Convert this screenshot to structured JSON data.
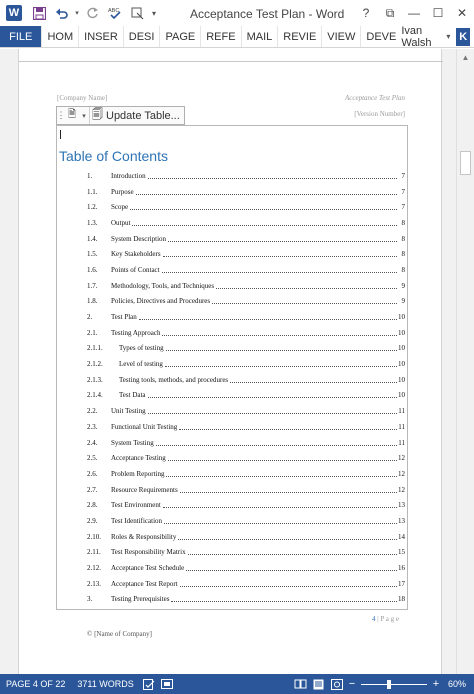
{
  "title_bar": {
    "app_logo": "W",
    "document_title": "Acceptance Test Plan - Word",
    "help": "?",
    "ribbon_display": "⧉",
    "minimize": "—",
    "maximize": "☐",
    "close": "✕",
    "quick_access": {
      "save_icon": "save-icon",
      "undo_icon": "undo-icon",
      "redo_icon": "redo-icon",
      "spelling_icon": "spelling-icon",
      "touch_mode_icon": "touch-mode-icon",
      "customize_icon": "customize-icon"
    }
  },
  "ribbon": {
    "file_tab": "FILE",
    "tabs": [
      "HOM",
      "INSER",
      "DESI",
      "PAGE",
      "REFE",
      "MAIL",
      "REVIE",
      "VIEW",
      "DEVE"
    ],
    "user_name": "Ivan Walsh",
    "user_avatar": "K"
  },
  "document": {
    "header_left": "[Company Name]",
    "header_right": "Acceptance Test Plan",
    "header_right_version": "[Version Number]",
    "update_table_label": "Update Table...",
    "toc_title": "Table of Contents",
    "toc": [
      {
        "num": "1.",
        "text": "Introduction",
        "page": "7",
        "level": 1
      },
      {
        "num": "1.1.",
        "text": "Purpose",
        "page": "7",
        "level": 2
      },
      {
        "num": "1.2.",
        "text": "Scope",
        "page": "7",
        "level": 2
      },
      {
        "num": "1.3.",
        "text": "Output",
        "page": "8",
        "level": 2
      },
      {
        "num": "1.4.",
        "text": "System Description",
        "page": "8",
        "level": 2
      },
      {
        "num": "1.5.",
        "text": "Key Stakeholders",
        "page": "8",
        "level": 2
      },
      {
        "num": "1.6.",
        "text": "Points of Contact",
        "page": "8",
        "level": 2
      },
      {
        "num": "1.7.",
        "text": "Methodology, Tools, and Techniques",
        "page": "9",
        "level": 2
      },
      {
        "num": "1.8.",
        "text": "Policies, Directives and Procedures",
        "page": "9",
        "level": 2
      },
      {
        "num": "2.",
        "text": "Test Plan",
        "page": "10",
        "level": 1
      },
      {
        "num": "2.1.",
        "text": "Testing Approach",
        "page": "10",
        "level": 2
      },
      {
        "num": "2.1.1.",
        "text": "Types of testing",
        "page": "10",
        "level": 3
      },
      {
        "num": "2.1.2.",
        "text": "Level of testing",
        "page": "10",
        "level": 3
      },
      {
        "num": "2.1.3.",
        "text": "Testing tools, methods, and procedures",
        "page": "10",
        "level": 3
      },
      {
        "num": "2.1.4.",
        "text": "Test Data",
        "page": "10",
        "level": 3
      },
      {
        "num": "2.2.",
        "text": "Unit Testing",
        "page": "11",
        "level": 2
      },
      {
        "num": "2.3.",
        "text": "Functional Unit Testing",
        "page": "11",
        "level": 2
      },
      {
        "num": "2.4.",
        "text": "System Testing",
        "page": "11",
        "level": 2
      },
      {
        "num": "2.5.",
        "text": "Acceptance Testing",
        "page": "12",
        "level": 2
      },
      {
        "num": "2.6.",
        "text": "Problem Reporting",
        "page": "12",
        "level": 2
      },
      {
        "num": "2.7.",
        "text": "Resource Requirements",
        "page": "12",
        "level": 2
      },
      {
        "num": "2.8.",
        "text": "Test Environment",
        "page": "13",
        "level": 2
      },
      {
        "num": "2.9.",
        "text": "Test Identification",
        "page": "13",
        "level": 2
      },
      {
        "num": "2.10.",
        "text": "Roles & Responsibility",
        "page": "14",
        "level": 2
      },
      {
        "num": "2.11.",
        "text": "Test Responsibility Matrix",
        "page": "15",
        "level": 2
      },
      {
        "num": "2.12.",
        "text": "Acceptance Test Schedule",
        "page": "16",
        "level": 2
      },
      {
        "num": "2.13.",
        "text": "Acceptance Test Report",
        "page": "17",
        "level": 2
      },
      {
        "num": "3.",
        "text": "Testing Prerequisites",
        "page": "18",
        "level": 1
      }
    ],
    "footer_page_number": "4",
    "footer_page_label": " | P a g e",
    "footer_company": "© [Name of Company]"
  },
  "status_bar": {
    "page_info": "PAGE 4 OF 22",
    "words": "3711 WORDS",
    "zoom_minus": "−",
    "zoom_plus": "+",
    "zoom_level": "60%",
    "zoom_fraction": 0.42
  },
  "colors": {
    "word_blue": "#2b579a",
    "heading_blue": "#2e74b5"
  }
}
